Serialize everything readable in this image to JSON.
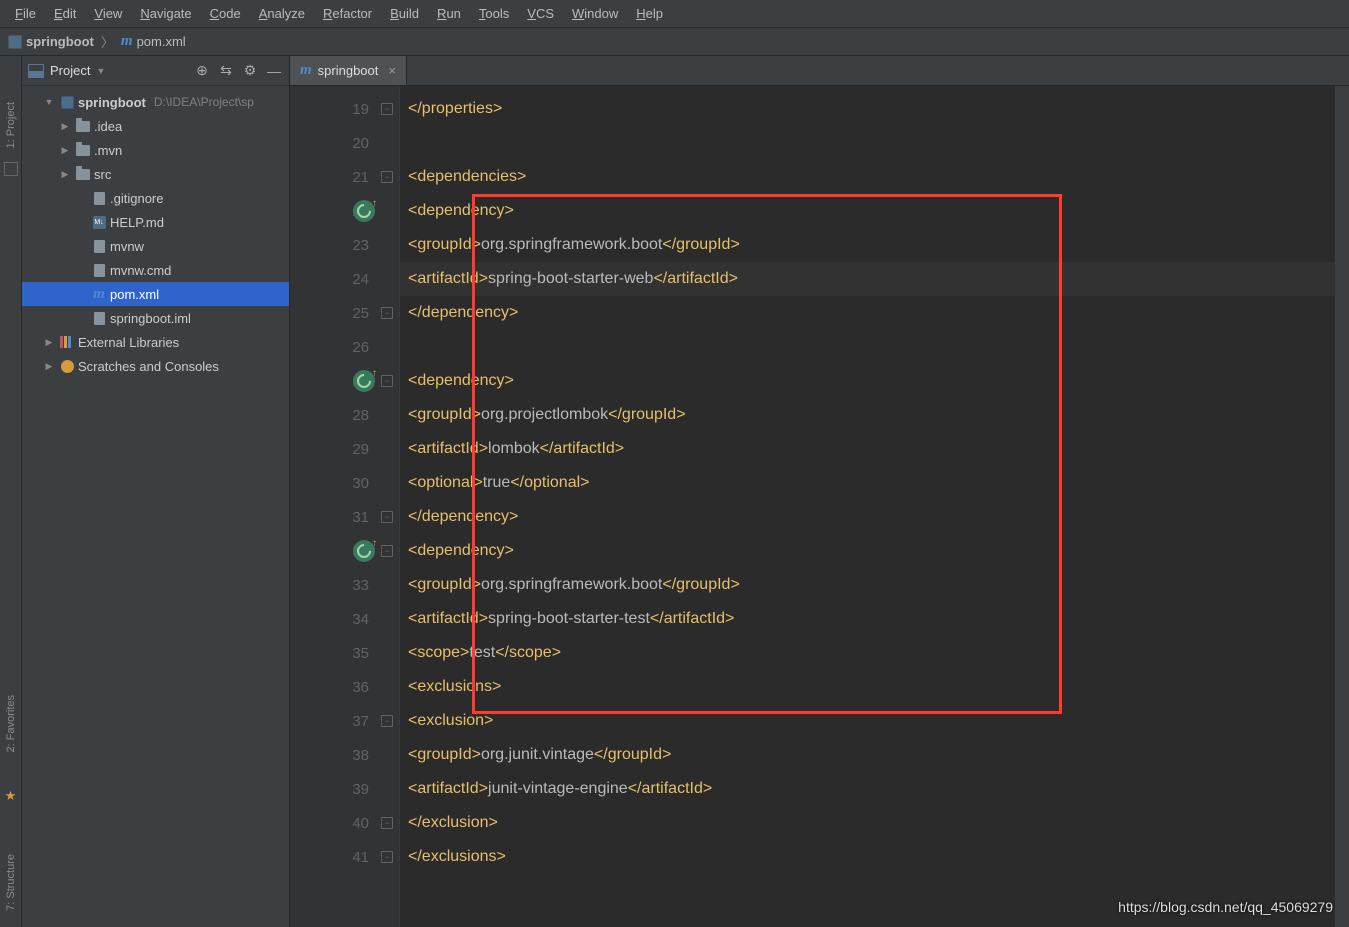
{
  "menu": [
    "File",
    "Edit",
    "View",
    "Navigate",
    "Code",
    "Analyze",
    "Refactor",
    "Build",
    "Run",
    "Tools",
    "VCS",
    "Window",
    "Help"
  ],
  "breadcrumb": {
    "project": "springboot",
    "file": "pom.xml"
  },
  "projectPanel": {
    "title": "Project"
  },
  "tree": {
    "root": {
      "name": "springboot",
      "path": "D:\\IDEA\\Project\\sp"
    },
    "items": [
      {
        "name": ".idea",
        "type": "folder",
        "expandable": true,
        "pad": 2
      },
      {
        "name": ".mvn",
        "type": "folder",
        "expandable": true,
        "pad": 2
      },
      {
        "name": "src",
        "type": "folder",
        "expandable": true,
        "pad": 2
      },
      {
        "name": ".gitignore",
        "type": "file",
        "pad": 3
      },
      {
        "name": "HELP.md",
        "type": "md",
        "pad": 3
      },
      {
        "name": "mvnw",
        "type": "file",
        "pad": 3
      },
      {
        "name": "mvnw.cmd",
        "type": "file",
        "pad": 3
      },
      {
        "name": "pom.xml",
        "type": "maven",
        "pad": 3,
        "selected": true
      },
      {
        "name": "springboot.iml",
        "type": "file",
        "pad": 3
      }
    ],
    "extlib": "External Libraries",
    "scratch": "Scratches and Consoles"
  },
  "tab": {
    "label": "springboot"
  },
  "sidetabs": {
    "project": "1: Project",
    "fav": "2: Favorites",
    "struct": "7: Structure"
  },
  "code": {
    "startLine": 19,
    "lines": [
      {
        "n": 19,
        "indent": 2,
        "tokens": [
          {
            "t": "br",
            "v": "</"
          },
          {
            "t": "tag",
            "v": "properties"
          },
          {
            "t": "br",
            "v": ">"
          }
        ],
        "fold": "-"
      },
      {
        "n": 20,
        "indent": 0,
        "tokens": []
      },
      {
        "n": 21,
        "indent": 2,
        "tokens": [
          {
            "t": "br",
            "v": "<"
          },
          {
            "t": "tag",
            "v": "dependencies"
          },
          {
            "t": "br",
            "v": ">"
          }
        ],
        "fold": "-"
      },
      {
        "n": 22,
        "indent": 3,
        "tokens": [
          {
            "t": "br",
            "v": "<"
          },
          {
            "t": "tag",
            "v": "dependency"
          },
          {
            "t": "br",
            "v": ">"
          }
        ],
        "spring": true
      },
      {
        "n": 23,
        "indent": 4,
        "tokens": [
          {
            "t": "br",
            "v": "<"
          },
          {
            "t": "tag",
            "v": "groupId"
          },
          {
            "t": "br",
            "v": ">"
          },
          {
            "t": "txt",
            "v": "org.springframework.boot"
          },
          {
            "t": "br",
            "v": "</"
          },
          {
            "t": "tag",
            "v": "groupId"
          },
          {
            "t": "br",
            "v": ">"
          }
        ]
      },
      {
        "n": 24,
        "indent": 4,
        "tokens": [
          {
            "t": "br",
            "v": "<"
          },
          {
            "t": "tag",
            "v": "artifactId"
          },
          {
            "t": "br",
            "v": ">"
          },
          {
            "t": "txt",
            "v": "spring-boot-starter-web"
          },
          {
            "t": "br",
            "v": "</"
          },
          {
            "t": "tag",
            "v": "artifactId"
          },
          {
            "t": "br",
            "v": ">"
          }
        ],
        "current": true
      },
      {
        "n": 25,
        "indent": 3,
        "tokens": [
          {
            "t": "br",
            "v": "</"
          },
          {
            "t": "tag",
            "v": "dependency"
          },
          {
            "t": "br",
            "v": ">"
          }
        ],
        "fold": "-"
      },
      {
        "n": 26,
        "indent": 0,
        "tokens": []
      },
      {
        "n": 27,
        "indent": 3,
        "tokens": [
          {
            "t": "br",
            "v": "<"
          },
          {
            "t": "tag",
            "v": "dependency"
          },
          {
            "t": "br",
            "v": ">"
          }
        ],
        "spring": true,
        "fold": "-"
      },
      {
        "n": 28,
        "indent": 4,
        "tokens": [
          {
            "t": "br",
            "v": "<"
          },
          {
            "t": "tag",
            "v": "groupId"
          },
          {
            "t": "br",
            "v": ">"
          },
          {
            "t": "txt",
            "v": "org.projectlombok"
          },
          {
            "t": "br",
            "v": "</"
          },
          {
            "t": "tag",
            "v": "groupId"
          },
          {
            "t": "br",
            "v": ">"
          }
        ]
      },
      {
        "n": 29,
        "indent": 4,
        "tokens": [
          {
            "t": "br",
            "v": "<"
          },
          {
            "t": "tag",
            "v": "artifactId"
          },
          {
            "t": "br",
            "v": ">"
          },
          {
            "t": "txt",
            "v": "lombok"
          },
          {
            "t": "br",
            "v": "</"
          },
          {
            "t": "tag",
            "v": "artifactId"
          },
          {
            "t": "br",
            "v": ">"
          }
        ]
      },
      {
        "n": 30,
        "indent": 4,
        "tokens": [
          {
            "t": "br",
            "v": "<"
          },
          {
            "t": "tag",
            "v": "optional"
          },
          {
            "t": "br",
            "v": ">"
          },
          {
            "t": "txt",
            "v": "true"
          },
          {
            "t": "br",
            "v": "</"
          },
          {
            "t": "tag",
            "v": "optional"
          },
          {
            "t": "br",
            "v": ">"
          }
        ]
      },
      {
        "n": 31,
        "indent": 3,
        "tokens": [
          {
            "t": "br",
            "v": "</"
          },
          {
            "t": "tag",
            "v": "dependency"
          },
          {
            "t": "br",
            "v": ">"
          }
        ],
        "fold": "-"
      },
      {
        "n": 32,
        "indent": 3,
        "tokens": [
          {
            "t": "br",
            "v": "<"
          },
          {
            "t": "tag",
            "v": "dependency"
          },
          {
            "t": "br",
            "v": ">"
          }
        ],
        "spring": true,
        "fold": "-"
      },
      {
        "n": 33,
        "indent": 4,
        "tokens": [
          {
            "t": "br",
            "v": "<"
          },
          {
            "t": "tag",
            "v": "groupId"
          },
          {
            "t": "br",
            "v": ">"
          },
          {
            "t": "txt",
            "v": "org.springframework.boot"
          },
          {
            "t": "br",
            "v": "</"
          },
          {
            "t": "tag",
            "v": "groupId"
          },
          {
            "t": "br",
            "v": ">"
          }
        ]
      },
      {
        "n": 34,
        "indent": 4,
        "tokens": [
          {
            "t": "br",
            "v": "<"
          },
          {
            "t": "tag",
            "v": "artifactId"
          },
          {
            "t": "br",
            "v": ">"
          },
          {
            "t": "txt",
            "v": "spring-boot-starter-test"
          },
          {
            "t": "br",
            "v": "</"
          },
          {
            "t": "tag",
            "v": "artifactId"
          },
          {
            "t": "br",
            "v": ">"
          }
        ]
      },
      {
        "n": 35,
        "indent": 4,
        "tokens": [
          {
            "t": "br",
            "v": "<"
          },
          {
            "t": "tag",
            "v": "scope"
          },
          {
            "t": "br",
            "v": ">"
          },
          {
            "t": "txt",
            "v": "test"
          },
          {
            "t": "br",
            "v": "</"
          },
          {
            "t": "tag",
            "v": "scope"
          },
          {
            "t": "br",
            "v": ">"
          }
        ]
      },
      {
        "n": 36,
        "indent": 4,
        "tokens": [
          {
            "t": "br",
            "v": "<"
          },
          {
            "t": "tag",
            "v": "exclusions"
          },
          {
            "t": "br",
            "v": ">"
          }
        ]
      },
      {
        "n": 37,
        "indent": 5,
        "tokens": [
          {
            "t": "br",
            "v": "<"
          },
          {
            "t": "tag",
            "v": "exclusion"
          },
          {
            "t": "br",
            "v": ">"
          }
        ],
        "fold": "-"
      },
      {
        "n": 38,
        "indent": 6,
        "tokens": [
          {
            "t": "br",
            "v": "<"
          },
          {
            "t": "tag",
            "v": "groupId"
          },
          {
            "t": "br",
            "v": ">"
          },
          {
            "t": "txt",
            "v": "org.junit.vintage"
          },
          {
            "t": "br",
            "v": "</"
          },
          {
            "t": "tag",
            "v": "groupId"
          },
          {
            "t": "br",
            "v": ">"
          }
        ]
      },
      {
        "n": 39,
        "indent": 6,
        "tokens": [
          {
            "t": "br",
            "v": "<"
          },
          {
            "t": "tag",
            "v": "artifactId"
          },
          {
            "t": "br",
            "v": ">"
          },
          {
            "t": "txt",
            "v": "junit-vintage-engine"
          },
          {
            "t": "br",
            "v": "</"
          },
          {
            "t": "tag",
            "v": "artifactId"
          },
          {
            "t": "br",
            "v": ">"
          }
        ]
      },
      {
        "n": 40,
        "indent": 5,
        "tokens": [
          {
            "t": "br",
            "v": "</"
          },
          {
            "t": "tag",
            "v": "exclusion"
          },
          {
            "t": "br",
            "v": ">"
          }
        ],
        "fold": "-"
      },
      {
        "n": 41,
        "indent": 4,
        "tokens": [
          {
            "t": "br",
            "v": "</"
          },
          {
            "t": "tag",
            "v": "exclusions"
          },
          {
            "t": "br",
            "v": ">"
          }
        ],
        "fold": "-"
      }
    ]
  },
  "watermark": "https://blog.csdn.net/qq_45069279"
}
